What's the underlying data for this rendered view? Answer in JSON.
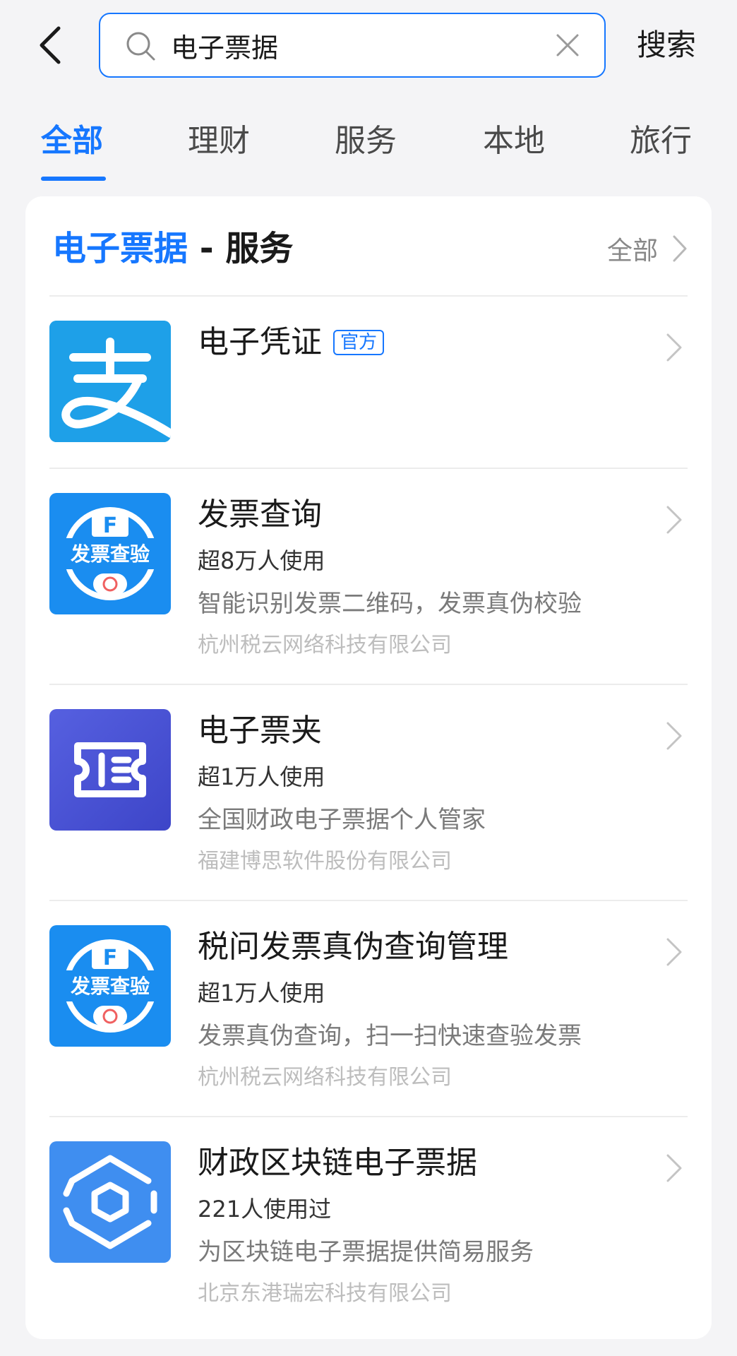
{
  "search": {
    "value": "电子票据",
    "button_label": "搜索"
  },
  "tabs": [
    {
      "label": "全部",
      "active": true
    },
    {
      "label": "理财",
      "active": false
    },
    {
      "label": "服务",
      "active": false
    },
    {
      "label": "本地",
      "active": false
    },
    {
      "label": "旅行",
      "active": false
    }
  ],
  "section": {
    "keyword": "电子票据",
    "separator": " - ",
    "category": "服务",
    "all_label": "全部"
  },
  "results": [
    {
      "name": "电子凭证",
      "badge": "官方",
      "users": "",
      "desc": "",
      "company": "",
      "logo": "alipay-logo"
    },
    {
      "name": "发票查询",
      "users": "超8万人使用",
      "desc": "智能识别发票二维码，发票真伪校验",
      "company": "杭州税云网络科技有限公司",
      "logo": "invoice-check-logo",
      "logo_text": "发票查验",
      "logo_letter": "F"
    },
    {
      "name": "电子票夹",
      "users": "超1万人使用",
      "desc": "全国财政电子票据个人管家",
      "company": "福建博思软件股份有限公司",
      "logo": "ticket-folder-logo"
    },
    {
      "name": "税问发票真伪查询管理",
      "users": "超1万人使用",
      "desc": "发票真伪查询，扫一扫快速查验发票",
      "company": "杭州税云网络科技有限公司",
      "logo": "invoice-check-logo",
      "logo_text": "发票查验",
      "logo_letter": "F"
    },
    {
      "name": "财政区块链电子票据",
      "users": "221人使用过",
      "desc": "为区块链电子票据提供简易服务",
      "company": "北京东港瑞宏科技有限公司",
      "logo": "blockchain-logo"
    }
  ],
  "colors": {
    "accent": "#1677ff",
    "alipay_blue": "#1ea0e8",
    "invoice_blue": "#1a8df0",
    "folder_purple": "#4a55d8",
    "blockchain_blue": "#3f8ef0"
  }
}
